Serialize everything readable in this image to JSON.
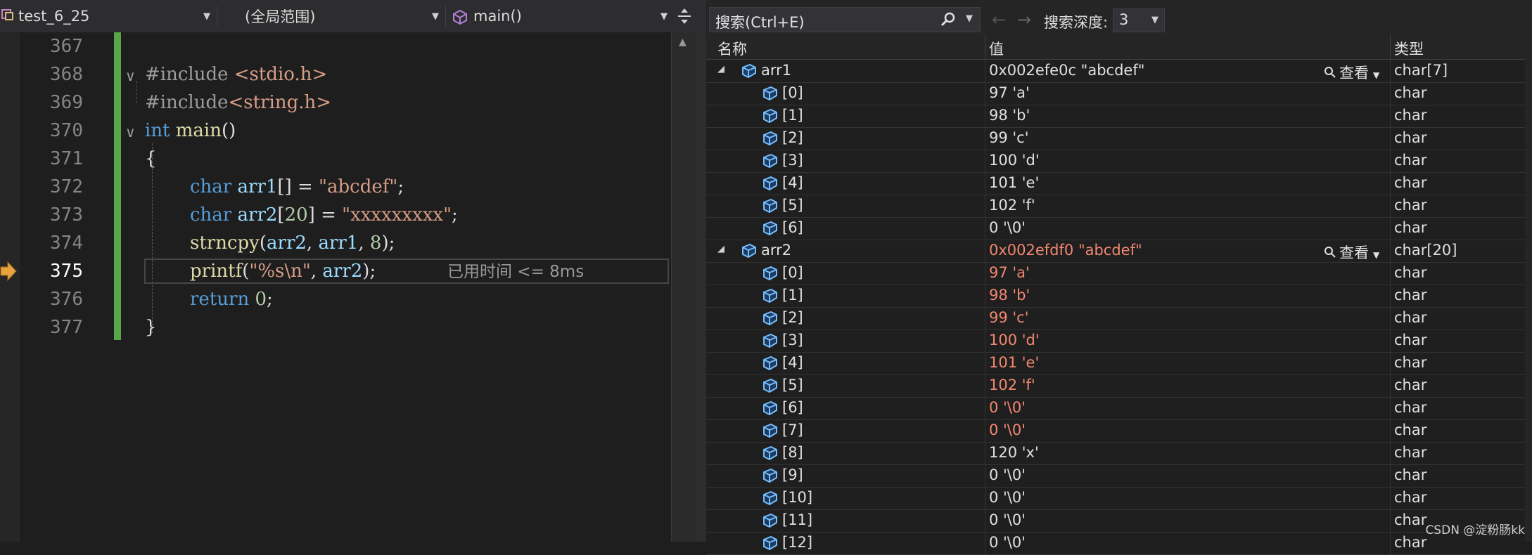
{
  "editor": {
    "project": "test_6_25",
    "scope": "(全局范围)",
    "function": "main()",
    "perf_tip": "已用时间 <= 8ms",
    "lines": [
      {
        "number": "367"
      },
      {
        "number": "368",
        "parts": [
          [
            "inc",
            "#include "
          ],
          [
            "str",
            "<stdio.h>"
          ]
        ]
      },
      {
        "number": "369",
        "parts": [
          [
            "inc",
            "#include"
          ],
          [
            "str",
            "<string.h>"
          ]
        ]
      },
      {
        "number": "370",
        "parts": [
          [
            "kw",
            "int "
          ],
          [
            "fn",
            "main"
          ],
          [
            "plain",
            "()"
          ]
        ]
      },
      {
        "number": "371",
        "parts": [
          [
            "plain",
            "{"
          ]
        ]
      },
      {
        "number": "372",
        "parts": [
          [
            "kw",
            "char "
          ],
          [
            "var",
            "arr1"
          ],
          [
            "plain",
            "[] = "
          ],
          [
            "str",
            "\"abcdef\""
          ],
          [
            "plain",
            ";"
          ]
        ]
      },
      {
        "number": "373",
        "parts": [
          [
            "kw",
            "char "
          ],
          [
            "var",
            "arr2"
          ],
          [
            "plain",
            "["
          ],
          [
            "num",
            "20"
          ],
          [
            "plain",
            "] = "
          ],
          [
            "str",
            "\"xxxxxxxxx\""
          ],
          [
            "plain",
            ";"
          ]
        ]
      },
      {
        "number": "374",
        "parts": [
          [
            "fn",
            "strncpy"
          ],
          [
            "plain",
            "("
          ],
          [
            "var",
            "arr2"
          ],
          [
            "plain",
            ", "
          ],
          [
            "var",
            "arr1"
          ],
          [
            "plain",
            ", "
          ],
          [
            "num",
            "8"
          ],
          [
            "plain",
            ");"
          ]
        ]
      },
      {
        "number": "375",
        "parts": [
          [
            "fn",
            "printf"
          ],
          [
            "plain",
            "("
          ],
          [
            "str",
            "\"%s\\n\""
          ],
          [
            "plain",
            ", "
          ],
          [
            "var",
            "arr2"
          ],
          [
            "plain",
            ");"
          ]
        ]
      },
      {
        "number": "376",
        "parts": [
          [
            "kw",
            "return "
          ],
          [
            "num",
            "0"
          ],
          [
            "plain",
            ";"
          ]
        ]
      },
      {
        "number": "377",
        "parts": [
          [
            "plain",
            "}"
          ]
        ]
      }
    ]
  },
  "watch": {
    "search_placeholder": "搜索(Ctrl+E)",
    "depth_label": "搜索深度:",
    "depth_value": "3",
    "columns": {
      "name": "名称",
      "value": "值",
      "type": "类型"
    },
    "view_label": "查看",
    "rows": [
      {
        "name": "arr1",
        "value": "0x002efe0c \"abcdef\"",
        "type": "char[7]",
        "level": 0,
        "changed": false,
        "expanded": true
      },
      {
        "name": "[0]",
        "value": "97 'a'",
        "type": "char",
        "level": 1,
        "changed": false
      },
      {
        "name": "[1]",
        "value": "98 'b'",
        "type": "char",
        "level": 1,
        "changed": false
      },
      {
        "name": "[2]",
        "value": "99 'c'",
        "type": "char",
        "level": 1,
        "changed": false
      },
      {
        "name": "[3]",
        "value": "100 'd'",
        "type": "char",
        "level": 1,
        "changed": false
      },
      {
        "name": "[4]",
        "value": "101 'e'",
        "type": "char",
        "level": 1,
        "changed": false
      },
      {
        "name": "[5]",
        "value": "102 'f'",
        "type": "char",
        "level": 1,
        "changed": false
      },
      {
        "name": "[6]",
        "value": "0 '\\0'",
        "type": "char",
        "level": 1,
        "changed": false
      },
      {
        "name": "arr2",
        "value": "0x002efdf0 \"abcdef\"",
        "type": "char[20]",
        "level": 0,
        "changed": true,
        "expanded": true
      },
      {
        "name": "[0]",
        "value": "97 'a'",
        "type": "char",
        "level": 1,
        "changed": true
      },
      {
        "name": "[1]",
        "value": "98 'b'",
        "type": "char",
        "level": 1,
        "changed": true
      },
      {
        "name": "[2]",
        "value": "99 'c'",
        "type": "char",
        "level": 1,
        "changed": true
      },
      {
        "name": "[3]",
        "value": "100 'd'",
        "type": "char",
        "level": 1,
        "changed": true
      },
      {
        "name": "[4]",
        "value": "101 'e'",
        "type": "char",
        "level": 1,
        "changed": true
      },
      {
        "name": "[5]",
        "value": "102 'f'",
        "type": "char",
        "level": 1,
        "changed": true
      },
      {
        "name": "[6]",
        "value": "0 '\\0'",
        "type": "char",
        "level": 1,
        "changed": true
      },
      {
        "name": "[7]",
        "value": "0 '\\0'",
        "type": "char",
        "level": 1,
        "changed": true
      },
      {
        "name": "[8]",
        "value": "120 'x'",
        "type": "char",
        "level": 1,
        "changed": false
      },
      {
        "name": "[9]",
        "value": "0 '\\0'",
        "type": "char",
        "level": 1,
        "changed": false
      },
      {
        "name": "[10]",
        "value": "0 '\\0'",
        "type": "char",
        "level": 1,
        "changed": false
      },
      {
        "name": "[11]",
        "value": "0 '\\0'",
        "type": "char",
        "level": 1,
        "changed": false
      },
      {
        "name": "[12]",
        "value": "0 '\\0'",
        "type": "char",
        "level": 1,
        "changed": false
      }
    ]
  },
  "watermark": "CSDN @淀粉肠kk",
  "colors": {
    "accent_green": "#57a64a",
    "changed_value": "#f48771",
    "keyword": "#569cd6"
  }
}
